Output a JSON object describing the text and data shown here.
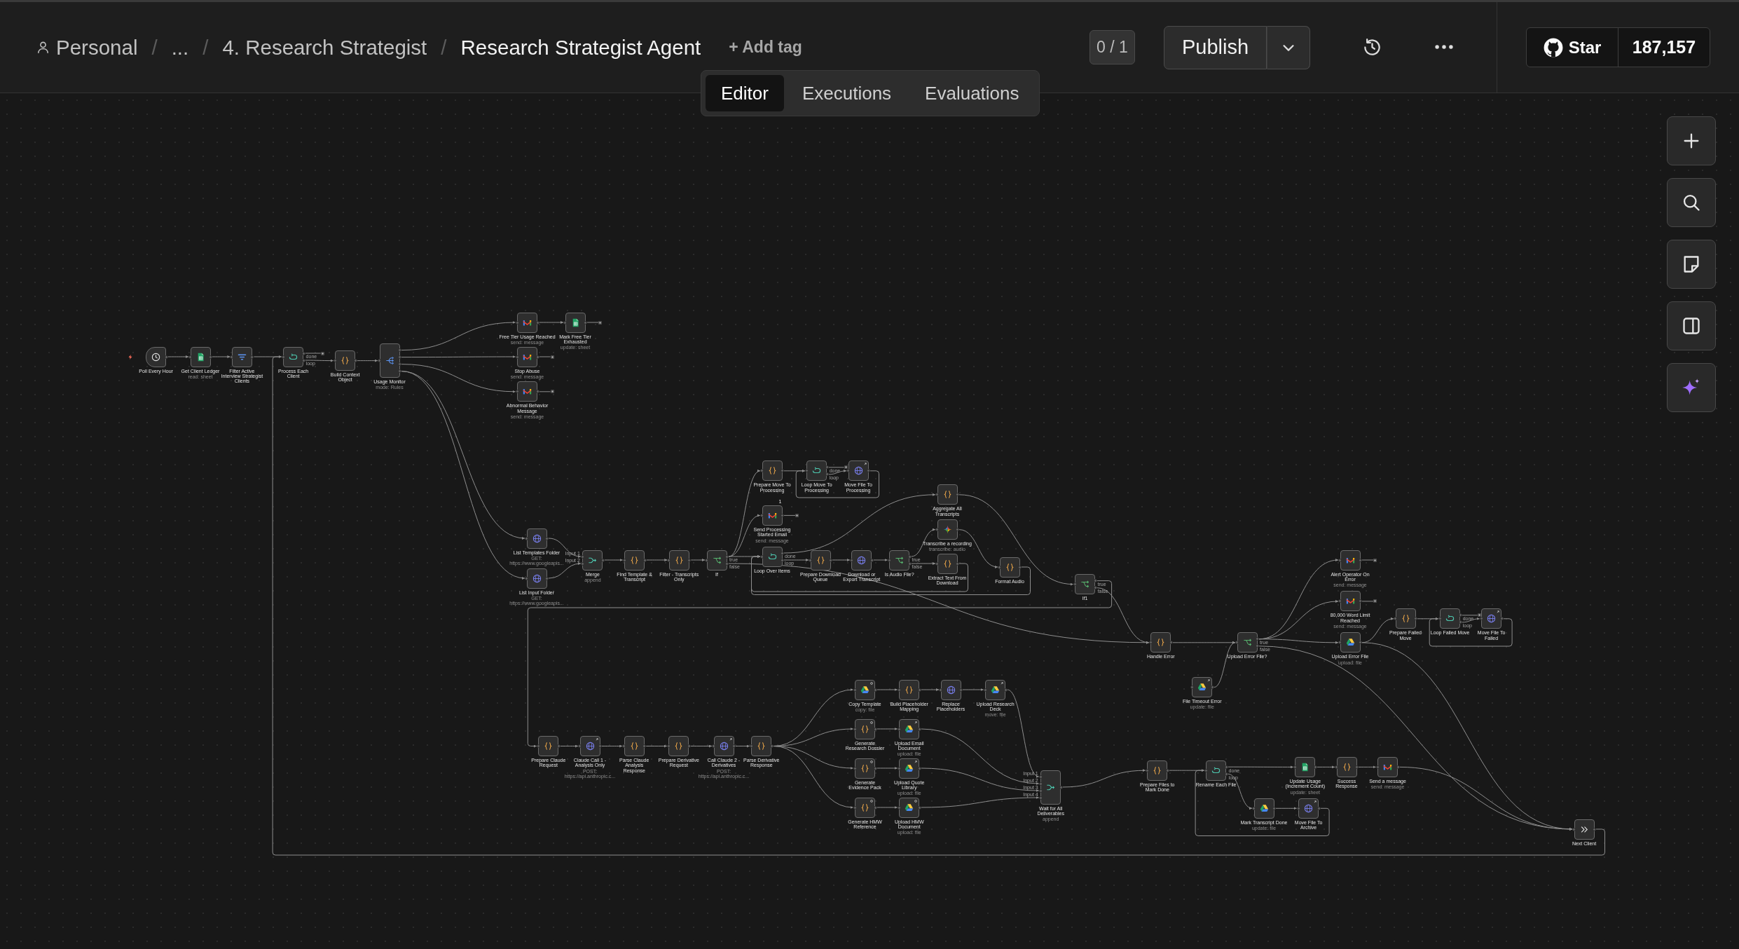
{
  "header": {
    "breadcrumb": [
      {
        "kind": "project",
        "label": "Personal"
      },
      {
        "kind": "separator",
        "label": "/"
      },
      {
        "kind": "more",
        "label": "..."
      },
      {
        "kind": "separator",
        "label": "/"
      },
      {
        "kind": "folder",
        "label": "4. Research Strategist"
      },
      {
        "kind": "separator",
        "label": "/"
      },
      {
        "kind": "current",
        "label": "Research Strategist Agent"
      }
    ],
    "add_tag": "+ Add tag",
    "version": "0 / 1",
    "publish": "Publish",
    "github": {
      "label": "Star",
      "count": "187,157"
    }
  },
  "tabs": [
    {
      "label": "Editor",
      "selected": true
    },
    {
      "label": "Executions",
      "selected": false
    },
    {
      "label": "Evaluations",
      "selected": false
    }
  ],
  "canvas": {
    "nodes": [
      {
        "label": "Poll Every Hour",
        "kind": "schedule_trigger"
      },
      {
        "label": "Get Client Ledger",
        "subtitle": "read: sheet",
        "kind": "sheets"
      },
      {
        "label": "Filter Active Interview Strategist Clients",
        "kind": "filter"
      },
      {
        "label": "Process Each Client",
        "kind": "loop",
        "outputs": [
          "done",
          "loop"
        ]
      },
      {
        "label": "Build Context Object",
        "kind": "code"
      },
      {
        "label": "Usage Monitor",
        "subtitle": "mode: Rules",
        "kind": "switch"
      },
      {
        "label": "Free Tier Usage Reached",
        "subtitle": "send: message",
        "kind": "mail"
      },
      {
        "label": "Mark Free Tier Exhausted",
        "subtitle": "update: sheet",
        "kind": "sheets"
      },
      {
        "label": "Stop Abuse",
        "subtitle": "send: message",
        "kind": "mail"
      },
      {
        "label": "Abnormal Behavior Message",
        "subtitle": "send: message",
        "kind": "mail"
      },
      {
        "label": "List Templates Folder",
        "subtitle": "GET: https://www.googleapis...",
        "kind": "http"
      },
      {
        "label": "List Input Folder",
        "subtitle": "GET: https://www.googleapis...",
        "kind": "http"
      },
      {
        "label": "Merge",
        "subtitle": "append",
        "kind": "merge",
        "inputs": [
          "Input 1",
          "Input 2"
        ]
      },
      {
        "label": "Find Template & Transcript",
        "kind": "code"
      },
      {
        "label": "Filter - Transcripts Only",
        "kind": "code"
      },
      {
        "label": "If",
        "kind": "if",
        "outputs": [
          "true",
          "false"
        ]
      },
      {
        "label": "Prepare Move To Processing",
        "kind": "code"
      },
      {
        "label": "Loop Move To Processing",
        "kind": "loop",
        "outputs": [
          "done",
          "loop"
        ]
      },
      {
        "label": "Move File To Processing",
        "kind": "http",
        "badge": {
          "kind": "arrow"
        }
      },
      {
        "label": "Send Processing Started Email",
        "subtitle": "send: message",
        "kind": "mail",
        "count": "1"
      },
      {
        "label": "Loop Over Items",
        "kind": "loop",
        "outputs": [
          "done",
          "loop"
        ]
      },
      {
        "label": "Prepare Download Queue",
        "kind": "code"
      },
      {
        "label": "Download or Export Transcript",
        "kind": "http"
      },
      {
        "label": "Is Audio File?",
        "kind": "if",
        "outputs": [
          "true",
          "false"
        ]
      },
      {
        "label": "Aggregate All Transcripts",
        "kind": "code"
      },
      {
        "label": "Transcribe a recording",
        "subtitle": "transcribe: audio",
        "kind": "ai_model"
      },
      {
        "label": "Extract Text From Download",
        "kind": "code"
      },
      {
        "label": "Format Audio",
        "kind": "code"
      },
      {
        "label": "If1",
        "kind": "if",
        "outputs": [
          "true",
          "false"
        ]
      },
      {
        "label": "Prepare Claude Request",
        "kind": "code"
      },
      {
        "label": "Claude Call 1 - Analysis Only",
        "subtitle": "POST: https://api.anthropic.c...",
        "kind": "http",
        "badge": {
          "kind": "arrow"
        }
      },
      {
        "label": "Parse Claude Analysis Response",
        "kind": "code"
      },
      {
        "label": "Prepare Derivative Request",
        "kind": "code"
      },
      {
        "label": "Call Claude 2 - Derivatives",
        "subtitle": "POST: https://api.anthropic.c...",
        "kind": "http",
        "badge": {
          "kind": "arrow"
        }
      },
      {
        "label": "Parse Derivative Response",
        "kind": "code"
      },
      {
        "label": "Copy Template",
        "subtitle": "copy: file",
        "kind": "drive",
        "badge": {
          "kind": "ring"
        }
      },
      {
        "label": "Build Placeholder Mapping",
        "kind": "code"
      },
      {
        "label": "Replace Placeholders",
        "kind": "http"
      },
      {
        "label": "Upload Research Deck",
        "subtitle": "move: file",
        "kind": "drive",
        "badge": {
          "kind": "arrow"
        }
      },
      {
        "label": "Generate Research Dossier",
        "kind": "code",
        "badge": {
          "kind": "ring"
        }
      },
      {
        "label": "Upload Email Document",
        "subtitle": "upload: file",
        "kind": "drive",
        "badge": {
          "kind": "arrow"
        }
      },
      {
        "label": "Generate Evidence Pack",
        "kind": "code",
        "badge": {
          "kind": "ring"
        }
      },
      {
        "label": "Upload Quote Library",
        "subtitle": "upload: file",
        "kind": "drive",
        "badge": {
          "kind": "arrow"
        }
      },
      {
        "label": "Generate HMW Reference",
        "kind": "code",
        "badge": {
          "kind": "ring"
        }
      },
      {
        "label": "Upload HMW Document",
        "subtitle": "upload: file",
        "kind": "drive",
        "badge": {
          "kind": "ring"
        }
      },
      {
        "label": "Wait for All Deliverables",
        "subtitle": "append",
        "kind": "merge",
        "inputs": [
          "Input 1",
          "Input 2",
          "Input 3",
          "Input 4"
        ]
      },
      {
        "label": "Handle Error",
        "kind": "code"
      },
      {
        "label": "Upload Error File?",
        "kind": "if",
        "outputs": [
          "true",
          "false"
        ]
      },
      {
        "label": "File Timeout Error",
        "subtitle": "update: file",
        "kind": "drive",
        "badge": {
          "kind": "arrow"
        }
      },
      {
        "label": "Alert Operator On Error",
        "subtitle": "send: message",
        "kind": "mail"
      },
      {
        "label": "80,000 Word Limit Reached",
        "subtitle": "send: message",
        "kind": "mail"
      },
      {
        "label": "Upload Error File",
        "subtitle": "upload: file",
        "kind": "drive"
      },
      {
        "label": "Prepare Failed Move",
        "kind": "code"
      },
      {
        "label": "Loop Failed Move",
        "kind": "loop",
        "outputs": [
          "done",
          "loop"
        ]
      },
      {
        "label": "Move File To Failed",
        "kind": "http",
        "badge": {
          "kind": "arrow"
        }
      },
      {
        "label": "Prepare Files to Mark Done",
        "kind": "code"
      },
      {
        "label": "Rename Each File",
        "kind": "loop",
        "outputs": [
          "done",
          "loop"
        ]
      },
      {
        "label": "Update Usage (Increment Count)",
        "subtitle": "update: sheet",
        "kind": "sheets"
      },
      {
        "label": "Success Response",
        "kind": "code"
      },
      {
        "label": "Send a message",
        "subtitle": "send: message",
        "kind": "mail"
      },
      {
        "label": "Mark Transcript Done",
        "subtitle": "update: file",
        "kind": "drive"
      },
      {
        "label": "Move File To Archive",
        "kind": "http",
        "badge": {
          "kind": "arrow"
        }
      },
      {
        "label": "Next Client",
        "kind": "noop"
      }
    ],
    "controls": [
      {
        "kind": "zoom_in"
      },
      {
        "kind": "search"
      },
      {
        "kind": "sticky_note"
      },
      {
        "kind": "panel"
      },
      {
        "kind": "ai"
      }
    ]
  }
}
